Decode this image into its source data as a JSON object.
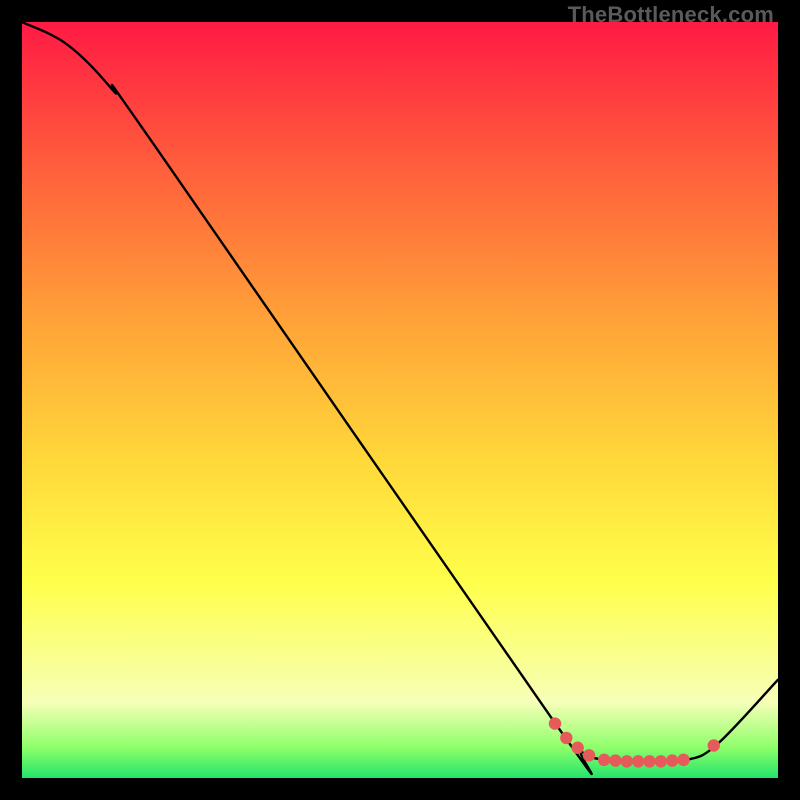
{
  "watermark": "TheBottleneck.com",
  "colors": {
    "bg_black": "#000000",
    "grad_top": "#ff1a44",
    "grad_mid1": "#ff5a3c",
    "grad_mid2": "#ffa438",
    "grad_mid3": "#ffd83a",
    "grad_yellow": "#ffff4a",
    "grad_pale": "#f6ffb8",
    "grad_green1": "#8dff6a",
    "grad_green2": "#23e36b",
    "marker": "#e65a5a",
    "curve": "#000000"
  },
  "chart_data": {
    "type": "line",
    "title": "",
    "xlabel": "",
    "ylabel": "",
    "xlim": [
      0,
      100
    ],
    "ylim": [
      0,
      100
    ],
    "curve": [
      {
        "x": 0,
        "y": 100
      },
      {
        "x": 6,
        "y": 97
      },
      {
        "x": 12,
        "y": 91
      },
      {
        "x": 18,
        "y": 83
      },
      {
        "x": 70,
        "y": 8
      },
      {
        "x": 74,
        "y": 3.5
      },
      {
        "x": 78,
        "y": 2.3
      },
      {
        "x": 84,
        "y": 2.2
      },
      {
        "x": 88,
        "y": 2.4
      },
      {
        "x": 92,
        "y": 4.5
      },
      {
        "x": 100,
        "y": 13
      }
    ],
    "markers": [
      {
        "x": 70.5,
        "y": 7.2
      },
      {
        "x": 72.0,
        "y": 5.3
      },
      {
        "x": 73.5,
        "y": 4.0
      },
      {
        "x": 75.0,
        "y": 3.0
      },
      {
        "x": 77.0,
        "y": 2.4
      },
      {
        "x": 78.5,
        "y": 2.3
      },
      {
        "x": 80.0,
        "y": 2.2
      },
      {
        "x": 81.5,
        "y": 2.2
      },
      {
        "x": 83.0,
        "y": 2.2
      },
      {
        "x": 84.5,
        "y": 2.2
      },
      {
        "x": 86.0,
        "y": 2.3
      },
      {
        "x": 87.5,
        "y": 2.4
      },
      {
        "x": 91.5,
        "y": 4.3
      }
    ]
  }
}
